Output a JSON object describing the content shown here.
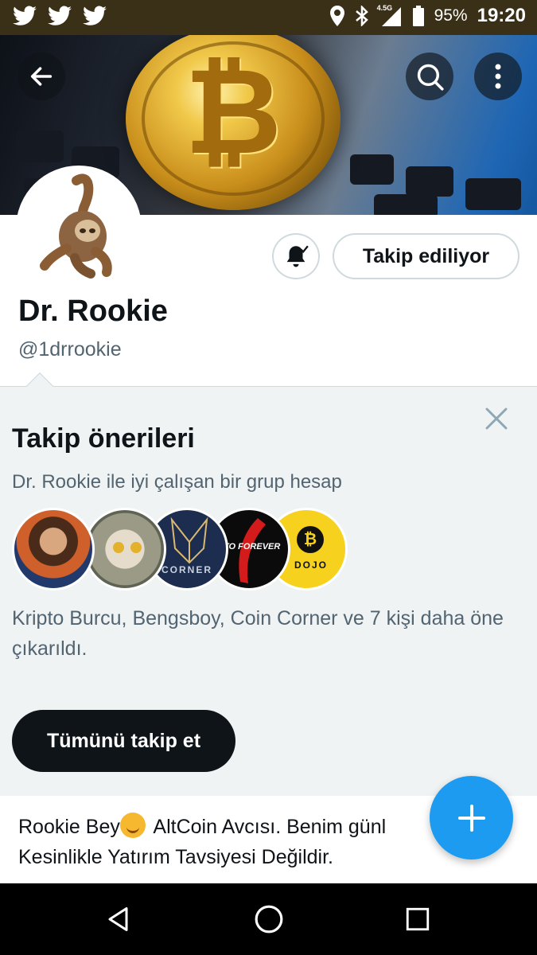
{
  "status_bar": {
    "left_icons": [
      "twitter-icon",
      "twitter-icon",
      "twitter-icon"
    ],
    "network": "4.5G",
    "battery": "95%",
    "time": "19:20"
  },
  "header": {
    "back_icon": "arrow-left-icon",
    "search_icon": "search-icon",
    "more_icon": "more-vertical-icon"
  },
  "profile": {
    "display_name": "Dr. Rookie",
    "handle": "@1drrookie",
    "following_label": "Takip ediliyor",
    "notification_icon": "bell-check-icon"
  },
  "suggestions": {
    "title": "Takip önerileri",
    "subtitle": "Dr. Rookie ile iyi çalışan bir grup hesap",
    "avatars": [
      {
        "label": ""
      },
      {
        "label": ""
      },
      {
        "label": "CORNER"
      },
      {
        "label": "PTO FOREVER"
      },
      {
        "label": "DOJO"
      }
    ],
    "description": "Kripto Burcu, Bengsboy, Coin Corner ve 7 kişi daha öne çıkarıldı.",
    "follow_all_label": "Tümünü takip et",
    "close_icon": "close-icon"
  },
  "bio": {
    "line1_a": "Rookie Bey",
    "line1_b": " AltCoin Avcısı.  Benim günl",
    "line2": "Kesinlikle Yatırım Tavsiyesi Değildir."
  },
  "fab": {
    "icon": "plus-icon"
  },
  "colors": {
    "accent": "#1d9bf0",
    "status_bar": "#3a2f17",
    "suggest_bg": "#eff3f4",
    "text_primary": "#0f1419",
    "text_secondary": "#536471"
  }
}
